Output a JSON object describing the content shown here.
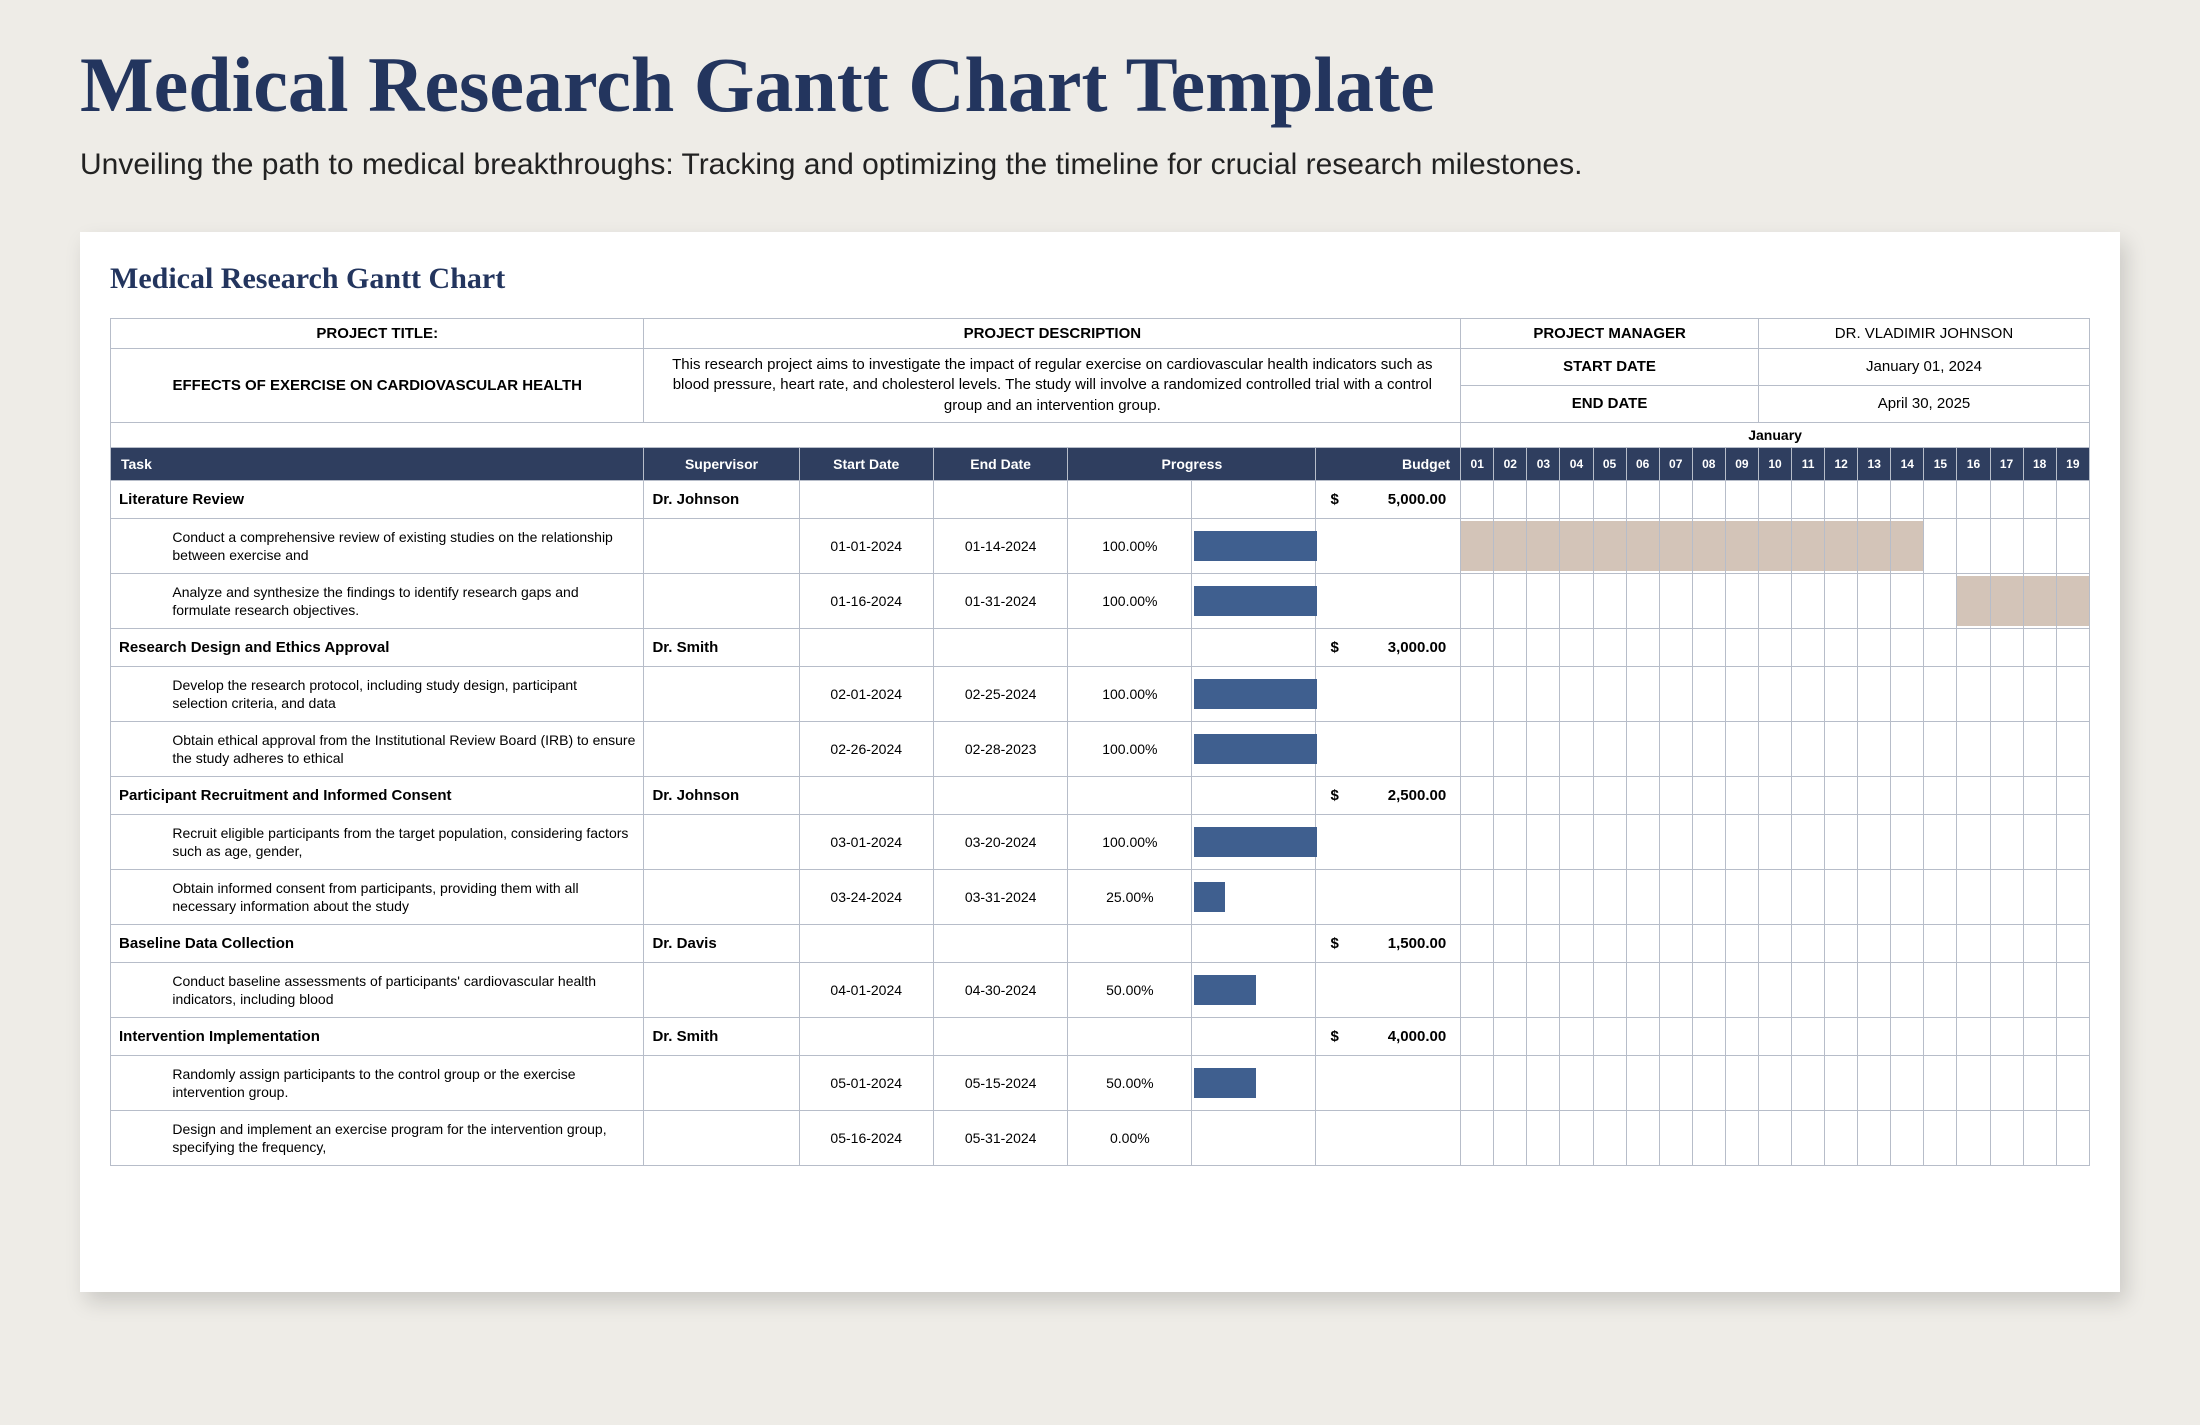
{
  "page": {
    "title": "Medical Research Gantt Chart Template",
    "subtitle": "Unveiling the path to medical breakthroughs: Tracking and optimizing the timeline for crucial research milestones."
  },
  "sheet": {
    "title": "Medical Research Gantt Chart"
  },
  "meta": {
    "project_title_label": "PROJECT TITLE:",
    "project_title": "EFFECTS OF EXERCISE ON CARDIOVASCULAR HEALTH",
    "project_desc_label": "PROJECT DESCRIPTION",
    "project_desc": "This research project aims to investigate the impact of regular exercise on cardiovascular health indicators such as blood pressure, heart rate, and cholesterol levels. The study will involve a randomized controlled trial with a control group and an intervention group.",
    "pm_label": "PROJECT MANAGER",
    "pm_value": "DR. VLADIMIR JOHNSON",
    "start_label": "START DATE",
    "start_value": "January 01, 2024",
    "end_label": "END DATE",
    "end_value": "April 30, 2025",
    "month": "January"
  },
  "cols": {
    "task": "Task",
    "supervisor": "Supervisor",
    "start": "Start Date",
    "end": "End Date",
    "progress": "Progress",
    "budget": "Budget"
  },
  "days": [
    "01",
    "02",
    "03",
    "04",
    "05",
    "06",
    "07",
    "08",
    "09",
    "10",
    "11",
    "12",
    "13",
    "14",
    "15",
    "16",
    "17",
    "18",
    "19"
  ],
  "phases": [
    {
      "name": "Literature Review",
      "supervisor": "Dr. Johnson",
      "budget": "5,000.00",
      "tasks": [
        {
          "name": "Conduct a comprehensive review of existing studies on the relationship between exercise and",
          "start": "01-01-2024",
          "end": "01-14-2024",
          "progress": "100.00%",
          "progWidth": 100,
          "gantt": [
            1,
            14
          ]
        },
        {
          "name": "Analyze and synthesize the findings to identify research gaps and formulate research objectives.",
          "start": "01-16-2024",
          "end": "01-31-2024",
          "progress": "100.00%",
          "progWidth": 100,
          "gantt": [
            16,
            19
          ]
        }
      ]
    },
    {
      "name": "Research Design and Ethics Approval",
      "supervisor": "Dr. Smith",
      "budget": "3,000.00",
      "tasks": [
        {
          "name": "Develop the research protocol, including study design, participant selection criteria, and data",
          "start": "02-01-2024",
          "end": "02-25-2024",
          "progress": "100.00%",
          "progWidth": 100,
          "gantt": null
        },
        {
          "name": "Obtain ethical approval from the Institutional Review Board (IRB) to ensure the study adheres to ethical",
          "start": "02-26-2024",
          "end": "02-28-2023",
          "progress": "100.00%",
          "progWidth": 100,
          "gantt": null
        }
      ]
    },
    {
      "name": "Participant Recruitment and Informed Consent",
      "supervisor": "Dr. Johnson",
      "budget": "2,500.00",
      "tasks": [
        {
          "name": "Recruit eligible participants from the target population, considering factors such as age, gender,",
          "start": "03-01-2024",
          "end": "03-20-2024",
          "progress": "100.00%",
          "progWidth": 100,
          "gantt": null
        },
        {
          "name": "Obtain informed consent from participants, providing them with all necessary information about the study",
          "start": "03-24-2024",
          "end": "03-31-2024",
          "progress": "25.00%",
          "progWidth": 25,
          "gantt": null
        }
      ]
    },
    {
      "name": "Baseline Data Collection",
      "supervisor": "Dr. Davis",
      "budget": "1,500.00",
      "tasks": [
        {
          "name": "Conduct baseline assessments of participants' cardiovascular health indicators, including blood",
          "start": "04-01-2024",
          "end": "04-30-2024",
          "progress": "50.00%",
          "progWidth": 50,
          "gantt": null
        }
      ]
    },
    {
      "name": "Intervention Implementation",
      "supervisor": "Dr. Smith",
      "budget": "4,000.00",
      "tasks": [
        {
          "name": "Randomly assign participants to the control group or the exercise intervention group.",
          "start": "05-01-2024",
          "end": "05-15-2024",
          "progress": "50.00%",
          "progWidth": 50,
          "gantt": null
        },
        {
          "name": "Design and implement an exercise program for the intervention group, specifying the frequency,",
          "start": "05-16-2024",
          "end": "05-31-2024",
          "progress": "0.00%",
          "progWidth": 0,
          "gantt": null
        }
      ]
    }
  ],
  "chart_data": {
    "type": "bar",
    "title": "Medical Research Gantt Chart",
    "xlabel": "Date",
    "ylabel": "Task",
    "series": [
      {
        "name": "Conduct a comprehensive review of existing studies",
        "start": "2024-01-01",
        "end": "2024-01-14",
        "progress": 100
      },
      {
        "name": "Analyze and synthesize the findings",
        "start": "2024-01-16",
        "end": "2024-01-31",
        "progress": 100
      },
      {
        "name": "Develop the research protocol",
        "start": "2024-02-01",
        "end": "2024-02-25",
        "progress": 100
      },
      {
        "name": "Obtain ethical approval from IRB",
        "start": "2024-02-26",
        "end": "2023-02-28",
        "progress": 100
      },
      {
        "name": "Recruit eligible participants",
        "start": "2024-03-01",
        "end": "2024-03-20",
        "progress": 100
      },
      {
        "name": "Obtain informed consent from participants",
        "start": "2024-03-24",
        "end": "2024-03-31",
        "progress": 25
      },
      {
        "name": "Conduct baseline assessments",
        "start": "2024-04-01",
        "end": "2024-04-30",
        "progress": 50
      },
      {
        "name": "Randomly assign participants",
        "start": "2024-05-01",
        "end": "2024-05-15",
        "progress": 50
      },
      {
        "name": "Design and implement exercise program",
        "start": "2024-05-16",
        "end": "2024-05-31",
        "progress": 0
      }
    ],
    "budgets": {
      "Literature Review": 5000,
      "Research Design and Ethics Approval": 3000,
      "Participant Recruitment and Informed Consent": 2500,
      "Baseline Data Collection": 1500,
      "Intervention Implementation": 4000
    },
    "visible_timeline": {
      "month": "January",
      "days": [
        1,
        19
      ]
    }
  }
}
